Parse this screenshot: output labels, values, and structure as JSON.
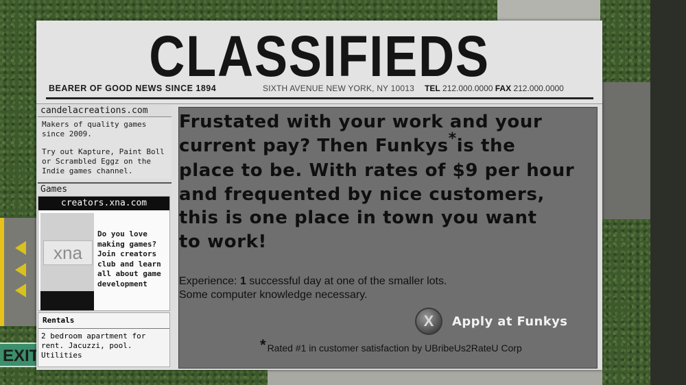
{
  "newspaper": {
    "title": "CLASSIFIEDS",
    "tagline": "BEARER OF GOOD NEWS SINCE 1894",
    "address": "SIXTH AVENUE NEW YORK, NY 10013",
    "tel_label": "TEL",
    "tel": "212.000.0000",
    "fax_label": "FAX",
    "fax": "212.000.0000"
  },
  "sidebar": {
    "site": "candelacreations.com",
    "intro": "Makers of quality games since 2009.",
    "promo": "Try out Kapture, Paint Boll or Scrambled Eggz on the Indie games channel.",
    "games_heading": "Games",
    "ad": {
      "url": "creators.xna.com",
      "logo_text": "xna",
      "text": "Do you love making games? Join creators club and learn all about game development"
    },
    "rentals": {
      "heading": "Rentals",
      "text": "2 bedroom apartment for rent. Jacuzzi, pool. Utilities"
    }
  },
  "job_ad": {
    "headline_lines": [
      "Frustated with your work and your",
      "current pay? Then Funkys",
      "is the",
      "place to be. With rates of $9 per hour",
      "and frequented by nice customers,",
      "this is one place in town you want",
      "to work!"
    ],
    "asterisk": "*",
    "experience_prefix": "Experience: ",
    "experience_count": "1",
    "experience_rest": " successful day  at one of the smaller lots.",
    "requirement": "Some computer knowledge necessary.",
    "apply_button_glyph": "X",
    "apply_label": "Apply at Funkys",
    "footnote": "Rated #1 in customer satisfaction by UBribeUs2RateU Corp"
  },
  "game_ui": {
    "exit_sign": "EXIT"
  }
}
